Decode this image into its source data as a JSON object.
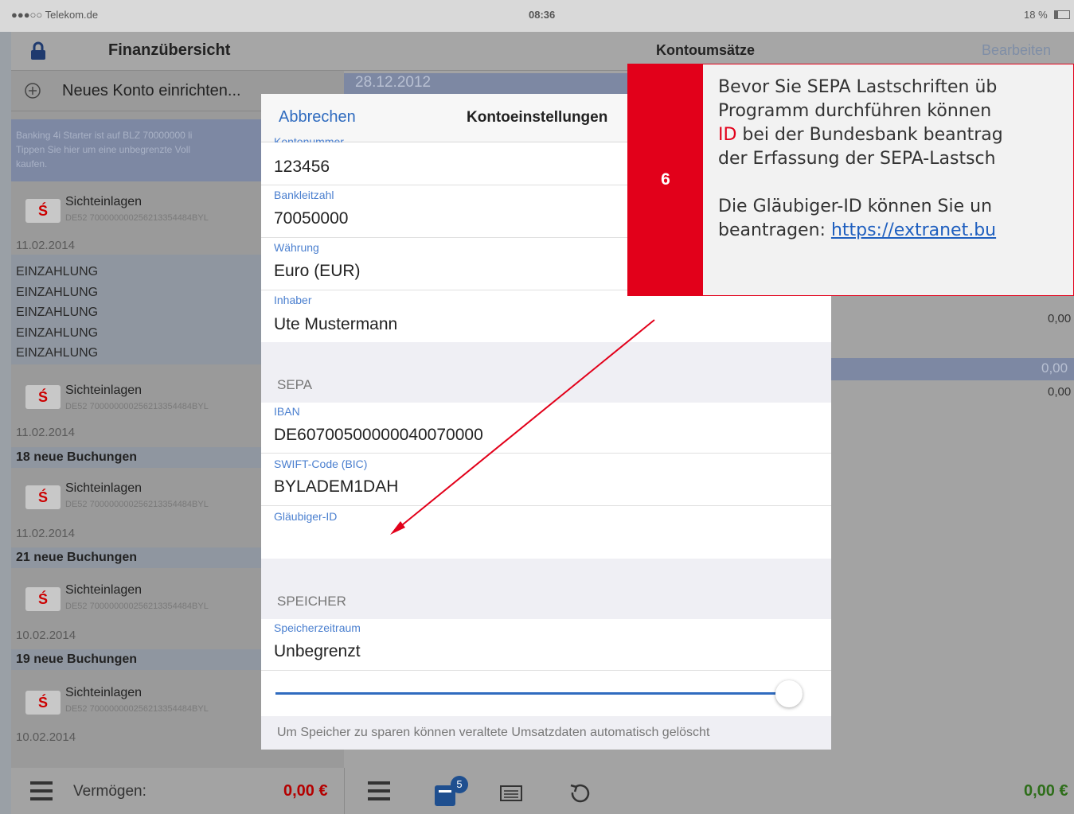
{
  "status_bar": {
    "carrier": "●●●○○ Telekom.de",
    "time": "08:36",
    "battery": "18 %"
  },
  "left_panel": {
    "title": "Finanzübersicht",
    "new_account": "Neues Konto einrichten...",
    "banner_line1": "Banking 4i Starter ist auf BLZ 70000000 li",
    "banner_line2": "Tippen Sie hier um eine unbegrenzte Voll",
    "banner_line3": "kaufen.",
    "accounts": [
      {
        "name": "Sichteinlagen",
        "iban": "DE52 700000000256213354484BYL",
        "date": "11.02.2014"
      },
      {
        "name": "Sichteinlagen",
        "iban": "DE52 700000000256213354484BYL",
        "date": "11.02.2014",
        "info": "18 neue Buchungen"
      },
      {
        "name": "Sichteinlagen",
        "iban": "DE52 700000000256213354484BYL",
        "date": "11.02.2014",
        "info": "21 neue Buchungen"
      },
      {
        "name": "Sichteinlagen",
        "iban": "DE52 700000000256213354484BYL",
        "date": "10.02.2014",
        "info": "19 neue Buchungen"
      },
      {
        "name": "Sichteinlagen",
        "iban": "DE52 700000000256213354484BYL",
        "date": "10.02.2014"
      }
    ],
    "deposits": [
      "EINZAHLUNG",
      "EINZAHLUNG",
      "EINZAHLUNG",
      "EINZAHLUNG",
      "EINZAHLUNG"
    ]
  },
  "right_panel": {
    "title": "Kontoumsätze",
    "edit": "Bearbeiten",
    "date_header": "28.12.2012",
    "amount1": "0,00",
    "amount2": "0,00",
    "amount3": "0,00"
  },
  "modal": {
    "cancel": "Abbrechen",
    "title": "Kontoeinstellungen",
    "fields": {
      "kontonummer_label": "Kontonummer",
      "kontonummer_value": "123456",
      "blz_label": "Bankleitzahl",
      "blz_value": "70050000",
      "waehrung_label": "Währung",
      "waehrung_value": "Euro (EUR)",
      "inhaber_label": "Inhaber",
      "inhaber_value": "Ute Mustermann",
      "iban_label": "IBAN",
      "iban_value": "DE60700500000040070000",
      "bic_label": "SWIFT-Code (BIC)",
      "bic_value": "BYLADEM1DAH",
      "glaeubiger_label": "Gläubiger-ID",
      "glaeubiger_value": "",
      "speicher_label": "Speicherzeitraum",
      "speicher_value": "Unbegrenzt"
    },
    "section_sepa": "SEPA",
    "section_speicher": "SPEICHER",
    "slider_value": 1.0,
    "footer_note": "Um Speicher zu sparen können veraltete Umsatzdaten automatisch gelöscht"
  },
  "callout": {
    "step": "6",
    "para1_a": "Bevor Sie SEPA Lastschriften üb",
    "para1_b": "Programm durchführen können",
    "para1_c_highlight": "ID",
    "para1_c_rest": " bei der Bundesbank beantrag",
    "para1_d": "der Erfassung der SEPA-Lastsch",
    "para2_a": "Die Gläubiger-ID können Sie un",
    "para2_b_prefix": "beantragen: ",
    "para2_b_link": "https://extranet.bu",
    "accent": "#e2001a"
  },
  "bottom_bar": {
    "vermoegen_label": "Vermögen:",
    "vermoegen_value": "0,00 €",
    "badge": "5",
    "right_amount": "0,00 €",
    "value_color": "#b40000",
    "right_color": "#2e6e1a"
  }
}
